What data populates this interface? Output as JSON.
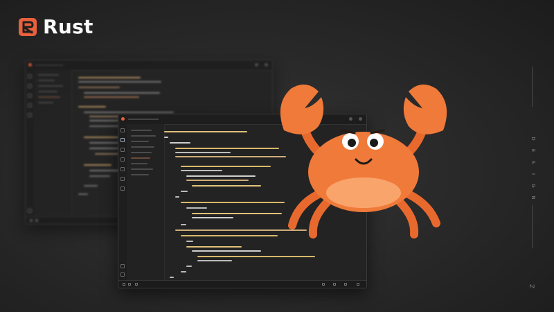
{
  "brand": {
    "name": "Rust",
    "logo_icon": "rust-logo-icon",
    "logo_color": "#e8603c"
  },
  "side_text": [
    "D",
    "E",
    "S",
    "I",
    "G",
    "N"
  ],
  "corner_glyph": "Z",
  "mascot": {
    "icon": "ferris-crab-icon",
    "color": "#f07a3a",
    "shade": "#d95a22",
    "belly": "#f9a46b"
  },
  "colors": {
    "background": "#262626",
    "window": "#232323",
    "keyword": "#e2c27a",
    "text": "#cfcfcf",
    "accent": "#e8603c"
  }
}
